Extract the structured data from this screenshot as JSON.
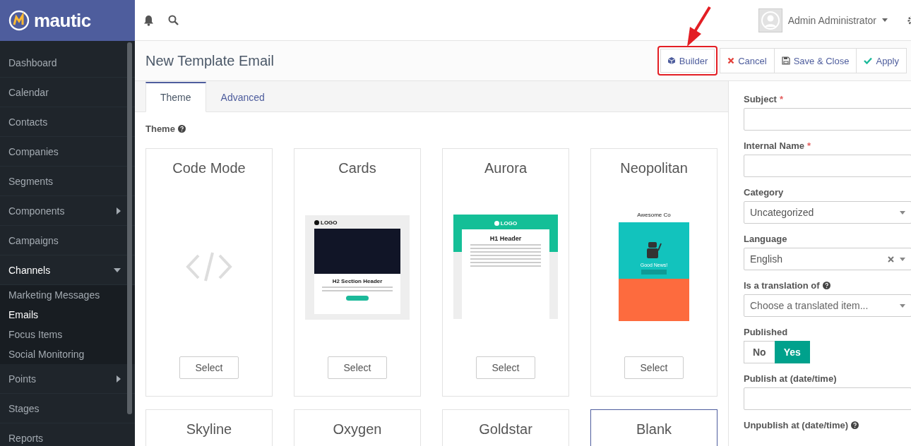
{
  "brand": {
    "name": "mautic"
  },
  "topbar": {
    "user": "Admin Administrator"
  },
  "sidebar": {
    "items": [
      {
        "label": "Dashboard",
        "selected": false
      },
      {
        "label": "Calendar",
        "selected": false
      },
      {
        "label": "Contacts",
        "selected": false
      },
      {
        "label": "Companies",
        "selected": false
      },
      {
        "label": "Segments",
        "selected": false
      },
      {
        "label": "Components",
        "selected": false,
        "expanded": false
      },
      {
        "label": "Campaigns",
        "selected": false
      },
      {
        "label": "Channels",
        "selected": false,
        "expanded": true,
        "children": [
          {
            "label": "Marketing Messages",
            "selected": false
          },
          {
            "label": "Emails",
            "selected": true
          },
          {
            "label": "Focus Items",
            "selected": false
          },
          {
            "label": "Social Monitoring",
            "selected": false
          }
        ]
      },
      {
        "label": "Points",
        "selected": false,
        "expanded": false
      },
      {
        "label": "Stages",
        "selected": false
      },
      {
        "label": "Reports",
        "selected": false
      }
    ]
  },
  "page": {
    "title": "New Template Email"
  },
  "actions": [
    {
      "label": "Builder",
      "kind": "cube",
      "highlighted": true
    },
    {
      "label": "Cancel",
      "kind": "times",
      "highlighted": false
    },
    {
      "label": "Save & Close",
      "kind": "save",
      "highlighted": false
    },
    {
      "label": "Apply",
      "kind": "check",
      "highlighted": false
    }
  ],
  "tabs": [
    {
      "label": "Theme",
      "selected": true
    },
    {
      "label": "Advanced",
      "selected": false
    }
  ],
  "theme_section": {
    "label": "Theme",
    "help": true
  },
  "themes": [
    {
      "name": "Code Mode",
      "selected": false,
      "button": "Select",
      "preview": {
        "kind": "code"
      }
    },
    {
      "name": "Cards",
      "selected": false,
      "button": "Select",
      "preview": {
        "kind": "cards",
        "texts": [
          "LOGO",
          "H2 Section Header"
        ]
      }
    },
    {
      "name": "Aurora",
      "selected": false,
      "button": "Select",
      "preview": {
        "kind": "aurora",
        "texts": [
          "LOGO",
          "H1 Header"
        ]
      }
    },
    {
      "name": "Neopolitan",
      "selected": false,
      "button": "Select",
      "preview": {
        "kind": "neopolitan",
        "texts": [
          "Awesome Co",
          "Good News!"
        ]
      }
    },
    {
      "name": "Skyline",
      "selected": false
    },
    {
      "name": "Oxygen",
      "selected": false
    },
    {
      "name": "Goldstar",
      "selected": false
    },
    {
      "name": "Blank",
      "selected": true
    }
  ],
  "fields": [
    {
      "kind": "text",
      "label": "Subject",
      "marker": "*"
    },
    {
      "kind": "text",
      "label": "Internal Name",
      "marker": "*"
    },
    {
      "kind": "select",
      "label": "Category",
      "value": "Uncategorized"
    },
    {
      "kind": "select",
      "label": "Language",
      "value": "English",
      "clearable": true
    },
    {
      "kind": "select",
      "label": "Is a translation of",
      "help": true,
      "placeholder": "Choose a translated item..."
    },
    {
      "kind": "toggle",
      "label": "Published",
      "options": [
        {
          "label": "No",
          "selected": false
        },
        {
          "label": "Yes",
          "selected": true
        }
      ]
    },
    {
      "kind": "text",
      "label": "Publish at (date/time)"
    },
    {
      "kind": "label",
      "label": "Unpublish at (date/time)",
      "help": true
    }
  ]
}
